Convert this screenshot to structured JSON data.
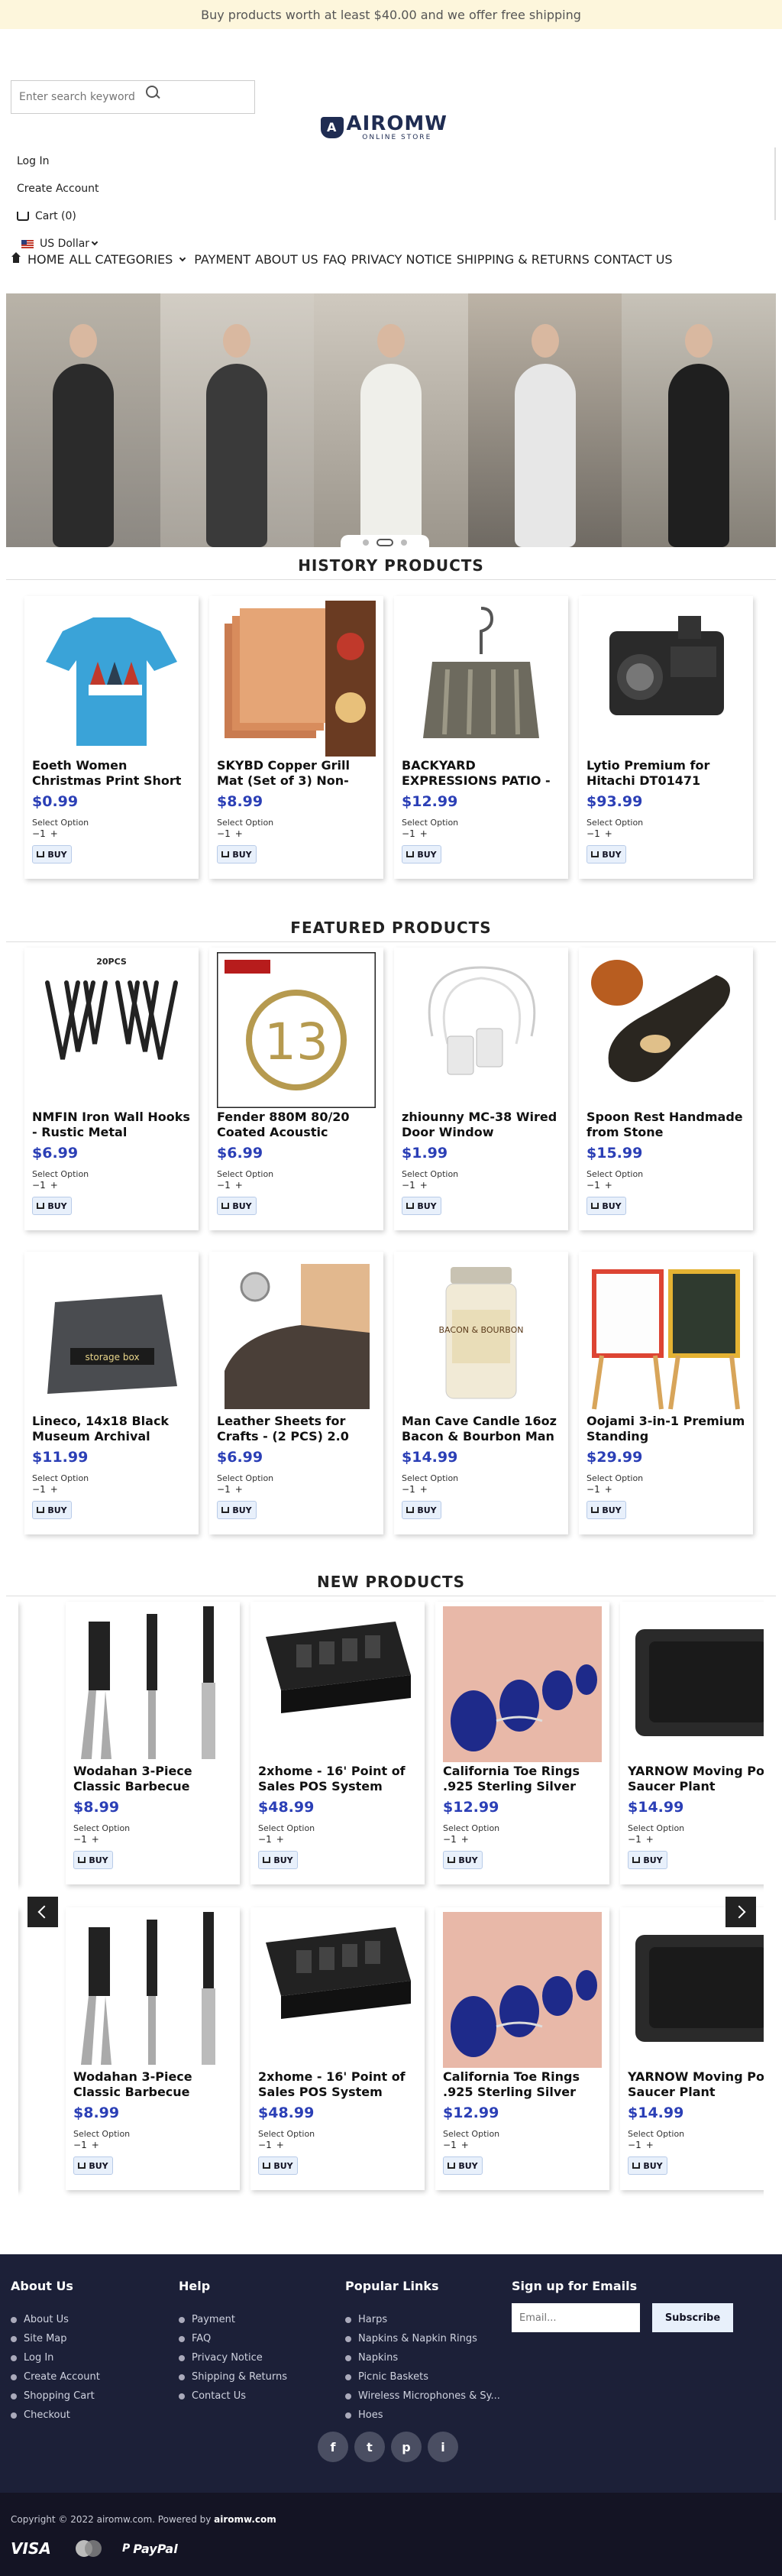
{
  "topbar": {
    "text": "Buy products worth at least $40.00 and we offer free shipping"
  },
  "header": {
    "search_placeholder": "Enter search keyword",
    "logo_brand": "AIROMW",
    "logo_sub": "ONLINE STORE",
    "login": "Log In",
    "create_account": "Create Account",
    "cart": "Cart (0)",
    "currency": "US Dollar"
  },
  "nav": {
    "home": "HOME",
    "all_categories": "ALL CATEGORIES",
    "payment": "PAYMENT",
    "about": "ABOUT US",
    "faq": "FAQ",
    "privacy": "PRIVACY NOTICE",
    "shipping": "SHIPPING & RETURNS",
    "contact": "CONTACT US"
  },
  "common": {
    "select_option": "Select Option",
    "buy": "BUY",
    "qty_minus": "−",
    "qty_value": "1",
    "qty_plus": "+"
  },
  "history": {
    "title": "HISTORY PRODUCTS",
    "products": [
      {
        "name": "Eoeth Women Christmas Print Short",
        "price": "$0.99"
      },
      {
        "name": "SKYBD Copper Grill Mat (Set of 3) Non-",
        "price": "$8.99"
      },
      {
        "name": "BACKYARD EXPRESSIONS PATIO -",
        "price": "$12.99"
      },
      {
        "name": "Lytio Premium for Hitachi DT01471",
        "price": "$93.99"
      }
    ]
  },
  "featured": {
    "title": "FEATURED PRODUCTS",
    "products": [
      {
        "name": "NMFIN Iron Wall Hooks - Rustic Metal",
        "price": "$6.99"
      },
      {
        "name": "Fender 880M 80/20 Coated Acoustic",
        "price": "$6.99"
      },
      {
        "name": "zhiounny MC-38 Wired Door Window",
        "price": "$1.99"
      },
      {
        "name": "Spoon Rest Handmade from Stone",
        "price": "$15.99"
      },
      {
        "name": "Lineco, 14x18 Black Museum Archival",
        "price": "$11.99"
      },
      {
        "name": "Leather Sheets for Crafts - (2 PCS) 2.0",
        "price": "$6.99"
      },
      {
        "name": "Man Cave Candle 16oz Bacon & Bourbon Man",
        "price": "$14.99"
      },
      {
        "name": "Oojami 3-in-1 Premium Standing",
        "price": "$29.99"
      }
    ]
  },
  "newp": {
    "title": "NEW PRODUCTS",
    "products": [
      {
        "name": "Wodahan 3-Piece Classic Barbecue",
        "price": "$8.99"
      },
      {
        "name": "2xhome - 16' Point of Sales POS System",
        "price": "$48.99"
      },
      {
        "name": "California Toe Rings .925 Sterling Silver",
        "price": "$12.99"
      },
      {
        "name": "YARNOW Moving Pot Saucer Plant",
        "price": "$14.99"
      }
    ]
  },
  "image_text": {
    "hooks_label": "20PCS",
    "fender_number": "13",
    "storage_box": "storage box",
    "candle_label": "BACON & BOURBON"
  },
  "footer": {
    "about_title": "About Us",
    "about_links": [
      "About Us",
      "Site Map",
      "Log In",
      "Create Account",
      "Shopping Cart",
      "Checkout"
    ],
    "help_title": "Help",
    "help_links": [
      "Payment",
      "FAQ",
      "Privacy Notice",
      "Shipping & Returns",
      "Contact Us"
    ],
    "popular_title": "Popular Links",
    "popular_links": [
      "Harps",
      "Napkins & Napkin Rings",
      "Napkins",
      "Picnic Baskets",
      "Wireless Microphones & Sy...",
      "Hoes"
    ],
    "signup_title": "Sign up for Emails",
    "email_placeholder": "Email...",
    "subscribe": "Subscribe",
    "social": [
      "f",
      "t",
      "p",
      "i"
    ]
  },
  "copyright": {
    "prefix": "Copyright © 2022 airomw.com. Powered by ",
    "brand": "airomw.com",
    "visa": "VISA",
    "paypal": "PayPal"
  },
  "colors": {
    "price": "#2b3fb6",
    "footer_bg": "#1c2038",
    "topbar_bg": "#fdf6dc"
  }
}
